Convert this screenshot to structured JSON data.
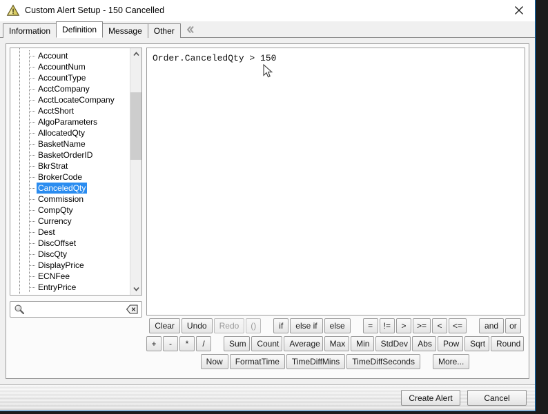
{
  "window": {
    "title": "Custom Alert Setup - 150 Cancelled",
    "icon": "warning-triangle-icon",
    "close_label": "×",
    "border_color": "#0a74c4"
  },
  "tabs": {
    "items": [
      {
        "label": "Information",
        "active": false
      },
      {
        "label": "Definition",
        "active": true
      },
      {
        "label": "Message",
        "active": false
      },
      {
        "label": "Other",
        "active": false
      }
    ],
    "overflow_icon": "double-chevron-left-icon"
  },
  "field_tree": {
    "selected": "CanceledQty",
    "items": [
      "Account",
      "AccountNum",
      "AccountType",
      "AcctCompany",
      "AcctLocateCompany",
      "AcctShort",
      "AlgoParameters",
      "AllocatedQty",
      "BasketName",
      "BasketOrderID",
      "BkrStrat",
      "BrokerCode",
      "CanceledQty",
      "Commission",
      "CompQty",
      "Currency",
      "Dest",
      "DiscOffset",
      "DiscQty",
      "DisplayPrice",
      "ECNFee",
      "EntryPrice"
    ],
    "selection_color": "#2a8cf0",
    "scroll_up_icon": "chevron-up-icon",
    "scroll_down_icon": "chevron-down-icon"
  },
  "search": {
    "value": "",
    "placeholder": "",
    "icon": "search-icon",
    "clear_icon": "backspace-clear-icon"
  },
  "expression": {
    "text": "Order.CanceledQty > 150",
    "cursor_icon": "mouse-pointer-arrow"
  },
  "keypad": {
    "row1": [
      {
        "label": "Clear",
        "disabled": false
      },
      {
        "label": "Undo",
        "disabled": false
      },
      {
        "label": "Redo",
        "disabled": true
      },
      {
        "label": "()",
        "disabled": true
      },
      {
        "gap": true
      },
      {
        "label": "if",
        "disabled": false
      },
      {
        "label": "else if",
        "disabled": false
      },
      {
        "label": "else",
        "disabled": false
      },
      {
        "gap": true
      },
      {
        "label": "=",
        "disabled": false
      },
      {
        "label": "!=",
        "disabled": false
      },
      {
        "label": ">",
        "disabled": false
      },
      {
        "label": ">=",
        "disabled": false
      },
      {
        "label": "<",
        "disabled": false
      },
      {
        "label": "<=",
        "disabled": false
      },
      {
        "gap": true
      },
      {
        "label": "and",
        "disabled": false
      },
      {
        "label": "or",
        "disabled": false
      }
    ],
    "row2": [
      {
        "label": "+",
        "disabled": false
      },
      {
        "label": "-",
        "disabled": false
      },
      {
        "label": "*",
        "disabled": false
      },
      {
        "label": "/",
        "disabled": false
      },
      {
        "gap": true
      },
      {
        "label": "Sum",
        "disabled": false
      },
      {
        "label": "Count",
        "disabled": false
      },
      {
        "label": "Average",
        "disabled": false
      },
      {
        "label": "Max",
        "disabled": false
      },
      {
        "label": "Min",
        "disabled": false
      },
      {
        "label": "StdDev",
        "disabled": false
      },
      {
        "label": "Abs",
        "disabled": false
      },
      {
        "label": "Pow",
        "disabled": false
      },
      {
        "label": "Sqrt",
        "disabled": false
      },
      {
        "label": "Round",
        "disabled": false
      }
    ],
    "row3": [
      {
        "label": "Now",
        "disabled": false
      },
      {
        "label": "FormatTime",
        "disabled": false
      },
      {
        "label": "TimeDiffMins",
        "disabled": false
      },
      {
        "label": "TimeDiffSeconds",
        "disabled": false
      },
      {
        "gap": true
      },
      {
        "label": "More...",
        "disabled": false
      }
    ]
  },
  "footer": {
    "primary_label": "Create Alert",
    "secondary_label": "Cancel"
  }
}
